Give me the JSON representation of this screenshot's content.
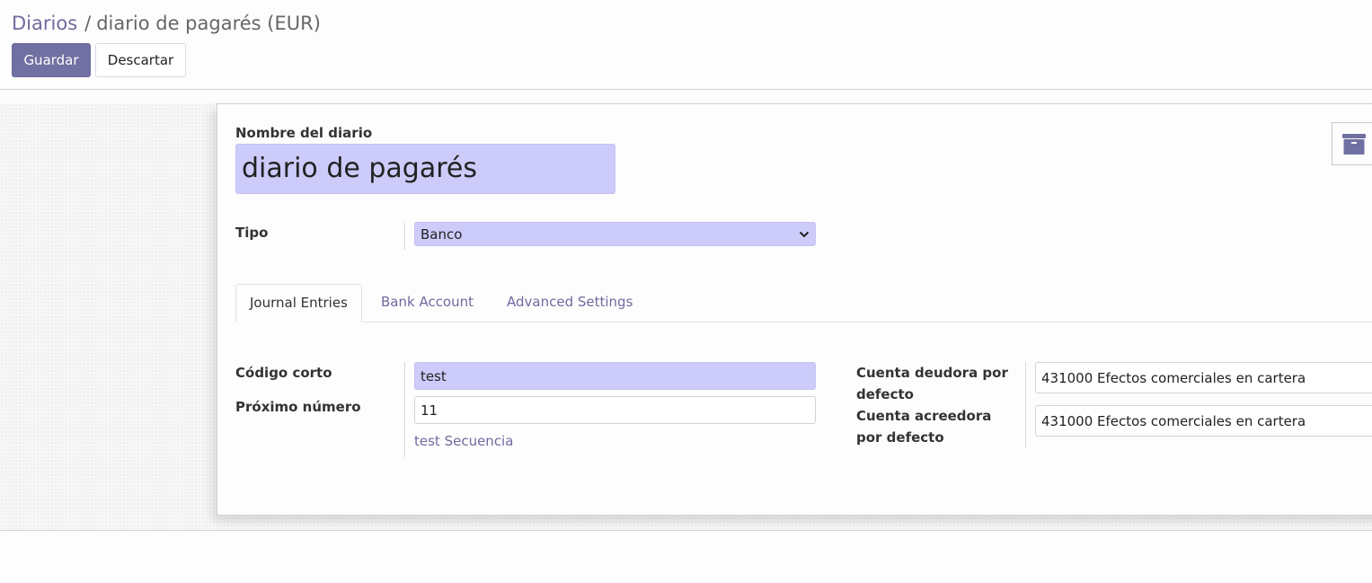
{
  "breadcrumb": {
    "parent": "Diarios",
    "separator": "/",
    "current": "diario de pagarés (EUR)"
  },
  "toolbar": {
    "save_label": "Guardar",
    "discard_label": "Descartar"
  },
  "form": {
    "archive_icon": "archive-box-icon",
    "name_label": "Nombre del diario",
    "name_value": "diario de pagarés",
    "type_label": "Tipo",
    "type_value": "Banco",
    "tabs": [
      {
        "label": "Journal Entries",
        "active": true
      },
      {
        "label": "Bank Account",
        "active": false
      },
      {
        "label": "Advanced Settings",
        "active": false
      }
    ],
    "journal_entries": {
      "short_code_label": "Código corto",
      "short_code_value": "test",
      "next_number_label": "Próximo número",
      "next_number_value": "11",
      "sequence_link": "test Secuencia",
      "default_debit_label": "Cuenta deudora por defecto",
      "default_debit_value": "431000 Efectos comerciales en cartera",
      "default_credit_label": "Cuenta acreedora por defecto",
      "default_credit_value": "431000 Efectos comerciales en cartera"
    }
  },
  "colors": {
    "primary": "#7170a2",
    "link": "#6f6b9f",
    "required_field": "#cccbfa"
  }
}
